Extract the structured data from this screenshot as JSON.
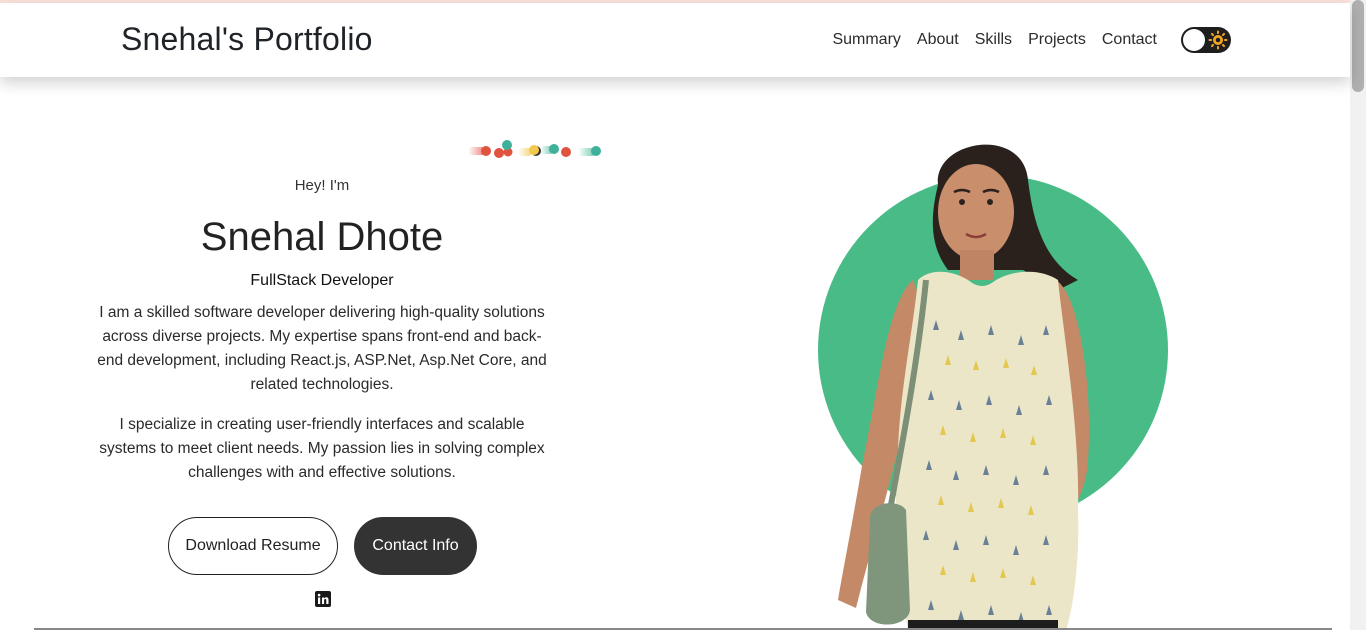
{
  "nav": {
    "brand": "Snehal's Portfolio",
    "links": [
      "Summary",
      "About",
      "Skills",
      "Projects",
      "Contact"
    ],
    "theme_toggle_icon": "sun-icon"
  },
  "hero": {
    "greeting": "Hey! I'm",
    "name": "Snehal Dhote",
    "role": "FullStack Developer",
    "paragraph1": "I am a skilled software developer delivering high-quality solutions across diverse projects. My expertise spans front-end and back-end development, including React.js, ASP.Net, Asp.Net Core, and related technologies.",
    "paragraph2": "I specialize in creating user-friendly interfaces and scalable systems to meet client needs. My passion lies in solving complex challenges with and effective solutions.",
    "download_button": "Download Resume",
    "contact_button": "Contact Info",
    "social_icon": "linkedin-icon"
  },
  "colors": {
    "accent_green": "#48bb87",
    "button_dark": "#333333"
  }
}
